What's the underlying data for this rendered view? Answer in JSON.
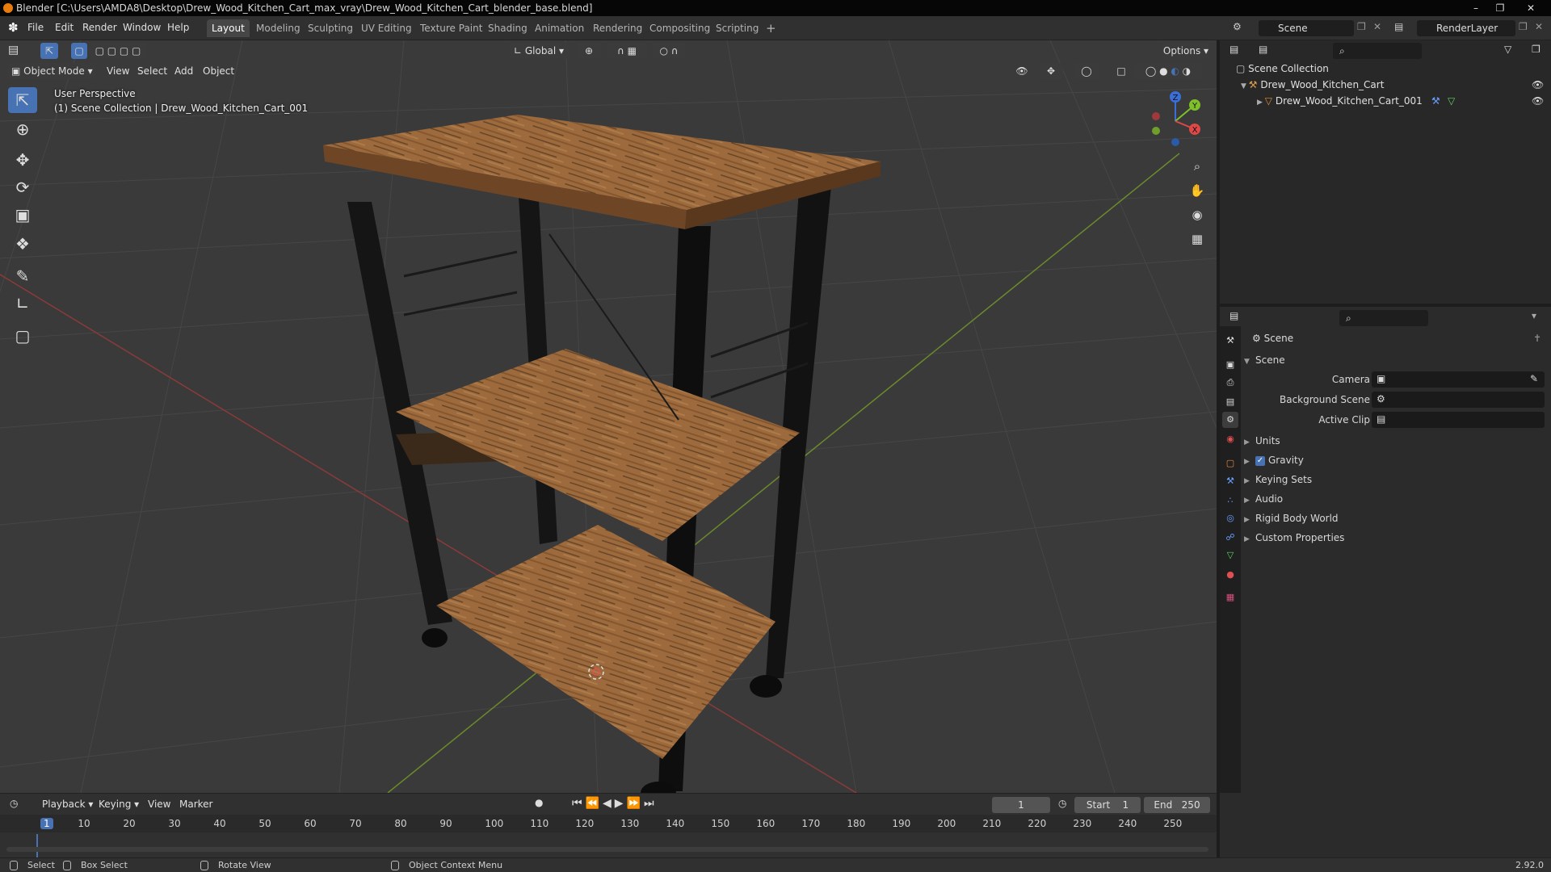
{
  "title": {
    "text": "Blender [C:\\Users\\AMDA8\\Desktop\\Drew_Wood_Kitchen_Cart_max_vray\\Drew_Wood_Kitchen_Cart_blender_base.blend]"
  },
  "menu": {
    "file": "File",
    "edit": "Edit",
    "render": "Render",
    "window": "Window",
    "help": "Help"
  },
  "workspaces": [
    "Layout",
    "Modeling",
    "Sculpting",
    "UV Editing",
    "Texture Paint",
    "Shading",
    "Animation",
    "Rendering",
    "Compositing",
    "Scripting"
  ],
  "active_workspace": "Layout",
  "scene_field": "Scene",
  "view_layer_field": "RenderLayer",
  "viewport": {
    "orientation": "Global",
    "options_label": "Options",
    "mode": "Object Mode",
    "menus": {
      "view": "View",
      "select": "Select",
      "add": "Add",
      "object": "Object"
    },
    "perspective_label": "User Perspective",
    "collection_label": "(1) Scene Collection | Drew_Wood_Kitchen_Cart_001",
    "gizmo": {
      "x": "X",
      "y": "Y",
      "z": "Z"
    }
  },
  "outliner": {
    "root": "Scene Collection",
    "collection": "Drew_Wood_Kitchen_Cart",
    "object": "Drew_Wood_Kitchen_Cart_001"
  },
  "properties": {
    "header": "Scene",
    "panel": "Scene",
    "fields": {
      "camera": "Camera",
      "background_scene": "Background Scene",
      "active_clip": "Active Clip"
    },
    "subpanels": {
      "units": "Units",
      "gravity": "Gravity",
      "keying_sets": "Keying Sets",
      "audio": "Audio",
      "rigid_body_world": "Rigid Body World",
      "custom_properties": "Custom Properties"
    },
    "gravity_enabled": true
  },
  "timeline": {
    "menus": {
      "playback": "Playback",
      "keying": "Keying",
      "view": "View",
      "marker": "Marker"
    },
    "current_frame": "1",
    "start_label": "Start",
    "start_value": "1",
    "end_label": "End",
    "end_value": "250",
    "ticks": [
      "1",
      "10",
      "20",
      "30",
      "40",
      "50",
      "60",
      "70",
      "80",
      "90",
      "100",
      "110",
      "120",
      "130",
      "140",
      "150",
      "160",
      "170",
      "180",
      "190",
      "200",
      "210",
      "220",
      "230",
      "240",
      "250"
    ]
  },
  "status": {
    "select": "Select",
    "box_select": "Box Select",
    "rotate_view": "Rotate View",
    "context_menu": "Object Context Menu",
    "version": "2.92.0"
  },
  "colors": {
    "accent": "#4772b3",
    "wood": "#9c6a3c",
    "metal": "#151515",
    "x_axis": "#8b3a3a",
    "y_axis": "#6b8a2c"
  }
}
